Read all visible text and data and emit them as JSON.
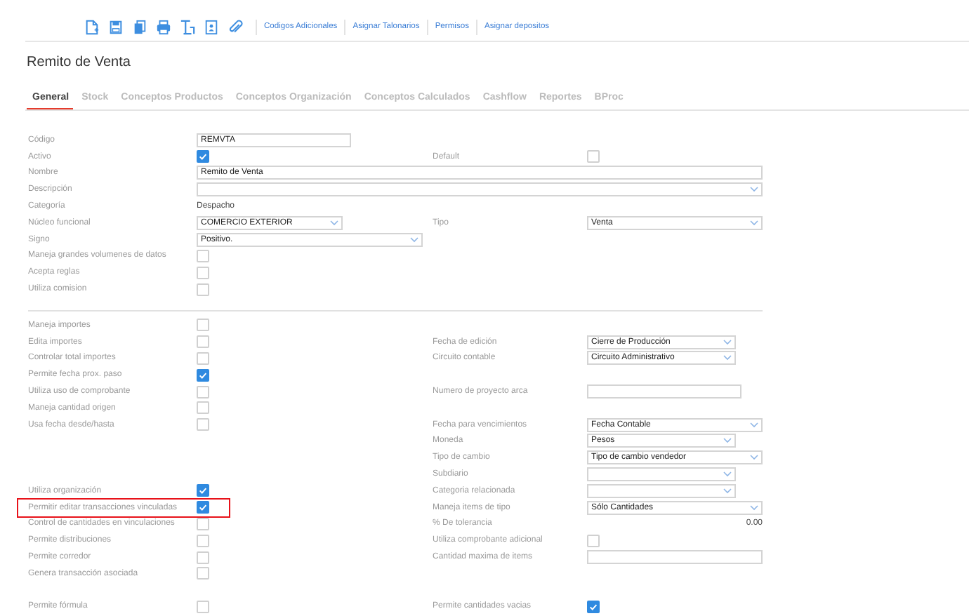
{
  "toolbar": {
    "links": [
      "Codigos Adicionales",
      "Asignar Talonarios",
      "Permisos",
      "Asignar depositos"
    ]
  },
  "title": "Remito de Venta",
  "tabs": [
    {
      "label": "General",
      "selected": true
    },
    {
      "label": "Stock",
      "selected": false
    },
    {
      "label": "Conceptos Productos",
      "selected": false
    },
    {
      "label": "Conceptos Organización",
      "selected": false
    },
    {
      "label": "Conceptos Calculados",
      "selected": false
    },
    {
      "label": "Cashflow",
      "selected": false
    },
    {
      "label": "Reportes",
      "selected": false
    },
    {
      "label": "BProc",
      "selected": false
    }
  ],
  "sections": [
    {
      "rows": [
        {
          "left": {
            "label": "Código",
            "kind": "input",
            "value": "REMVTA"
          }
        },
        {
          "left": {
            "label": "Activo",
            "kind": "checkbox",
            "checked": true
          },
          "right": {
            "label": "Default",
            "kind": "checkbox",
            "checked": false
          }
        },
        {
          "left": {
            "label": "Nombre",
            "kind": "full-input",
            "value": "Remito de Venta"
          }
        },
        {
          "left": {
            "label": "Descripción",
            "kind": "full-select"
          }
        },
        {
          "left": {
            "label": "Categoría",
            "kind": "text",
            "value": "Despacho"
          }
        },
        {
          "left": {
            "label": "Núcleo funcional",
            "kind": "short-select",
            "value": "COMERCIO EXTERIOR"
          },
          "right": {
            "label": "Tipo",
            "kind": "wide-select",
            "value": "Venta"
          }
        },
        {
          "left": {
            "label": "Signo",
            "kind": "mid-select",
            "value": "Positivo."
          }
        },
        {
          "left": {
            "label": "Maneja grandes volumenes de datos",
            "kind": "checkbox",
            "checked": false
          }
        },
        {
          "left": {
            "label": "Acepta reglas",
            "kind": "checkbox",
            "checked": false
          }
        },
        {
          "left": {
            "label": "Utiliza comision",
            "kind": "checkbox",
            "checked": false
          }
        }
      ]
    },
    {
      "rows": [
        {
          "left": {
            "label": "Maneja importes",
            "kind": "checkbox",
            "checked": false
          }
        },
        {
          "left": {
            "label": "Edita importes",
            "kind": "checkbox",
            "checked": false
          },
          "right": {
            "label": "Fecha de edición",
            "kind": "select",
            "value": "Cierre de Producción"
          }
        },
        {
          "left": {
            "label": "Controlar total importes",
            "kind": "checkbox",
            "checked": false
          },
          "right": {
            "label": "Circuito contable",
            "kind": "select",
            "value": "Circuito Administrativo"
          }
        },
        {
          "left": {
            "label": "Permite fecha prox. paso",
            "kind": "checkbox",
            "checked": true
          }
        },
        {
          "left": {
            "label": "Utiliza uso de comprobante",
            "kind": "checkbox",
            "checked": false
          },
          "right": {
            "label": "Numero de proyecto arca",
            "kind": "input"
          }
        },
        {
          "left": {
            "label": "Maneja cantidad origen",
            "kind": "checkbox",
            "checked": false
          }
        },
        {
          "left": {
            "label": "Usa fecha desde/hasta",
            "kind": "checkbox",
            "checked": false
          },
          "right": {
            "label": "Fecha para vencimientos",
            "kind": "wide-select",
            "value": "Fecha Contable"
          }
        },
        {
          "right": {
            "label": "Moneda",
            "kind": "select",
            "value": "Pesos"
          }
        },
        {
          "right": {
            "label": "Tipo de cambio",
            "kind": "wide-select",
            "value": "Tipo de cambio vendedor"
          }
        },
        {
          "right": {
            "label": "Subdiario",
            "kind": "select"
          }
        },
        {
          "left": {
            "label": "Utiliza organización",
            "kind": "checkbox",
            "checked": true
          },
          "right": {
            "label": "Categoria relacionada",
            "kind": "select"
          }
        },
        {
          "highlighted": true,
          "left": {
            "label": "Permitir editar transacciones vinculadas",
            "kind": "checkbox",
            "checked": true
          },
          "right": {
            "label": "Maneja items de tipo",
            "kind": "wide-select",
            "value": "Sólo Cantidades"
          }
        },
        {
          "left": {
            "label": "Control de cantidades en vinculaciones",
            "kind": "checkbox",
            "checked": false
          },
          "right": {
            "label": "% De tolerancia",
            "kind": "number",
            "value": "0.00"
          }
        },
        {
          "left": {
            "label": "Permite distribuciones",
            "kind": "checkbox",
            "checked": false
          },
          "right": {
            "label": "Utiliza comprobante adicional",
            "kind": "checkbox",
            "checked": false
          }
        },
        {
          "left": {
            "label": "Permite corredor",
            "kind": "checkbox",
            "checked": false
          },
          "right": {
            "label": "Cantidad maxima de items",
            "kind": "wide-input"
          }
        },
        {
          "left": {
            "label": "Genera transacción asociada",
            "kind": "checkbox",
            "checked": false
          }
        },
        {},
        {
          "left": {
            "label": "Permite fórmula",
            "kind": "checkbox",
            "checked": false
          },
          "right": {
            "label": "Permite cantidades vacias",
            "kind": "checkbox",
            "checked": true
          }
        }
      ]
    }
  ]
}
